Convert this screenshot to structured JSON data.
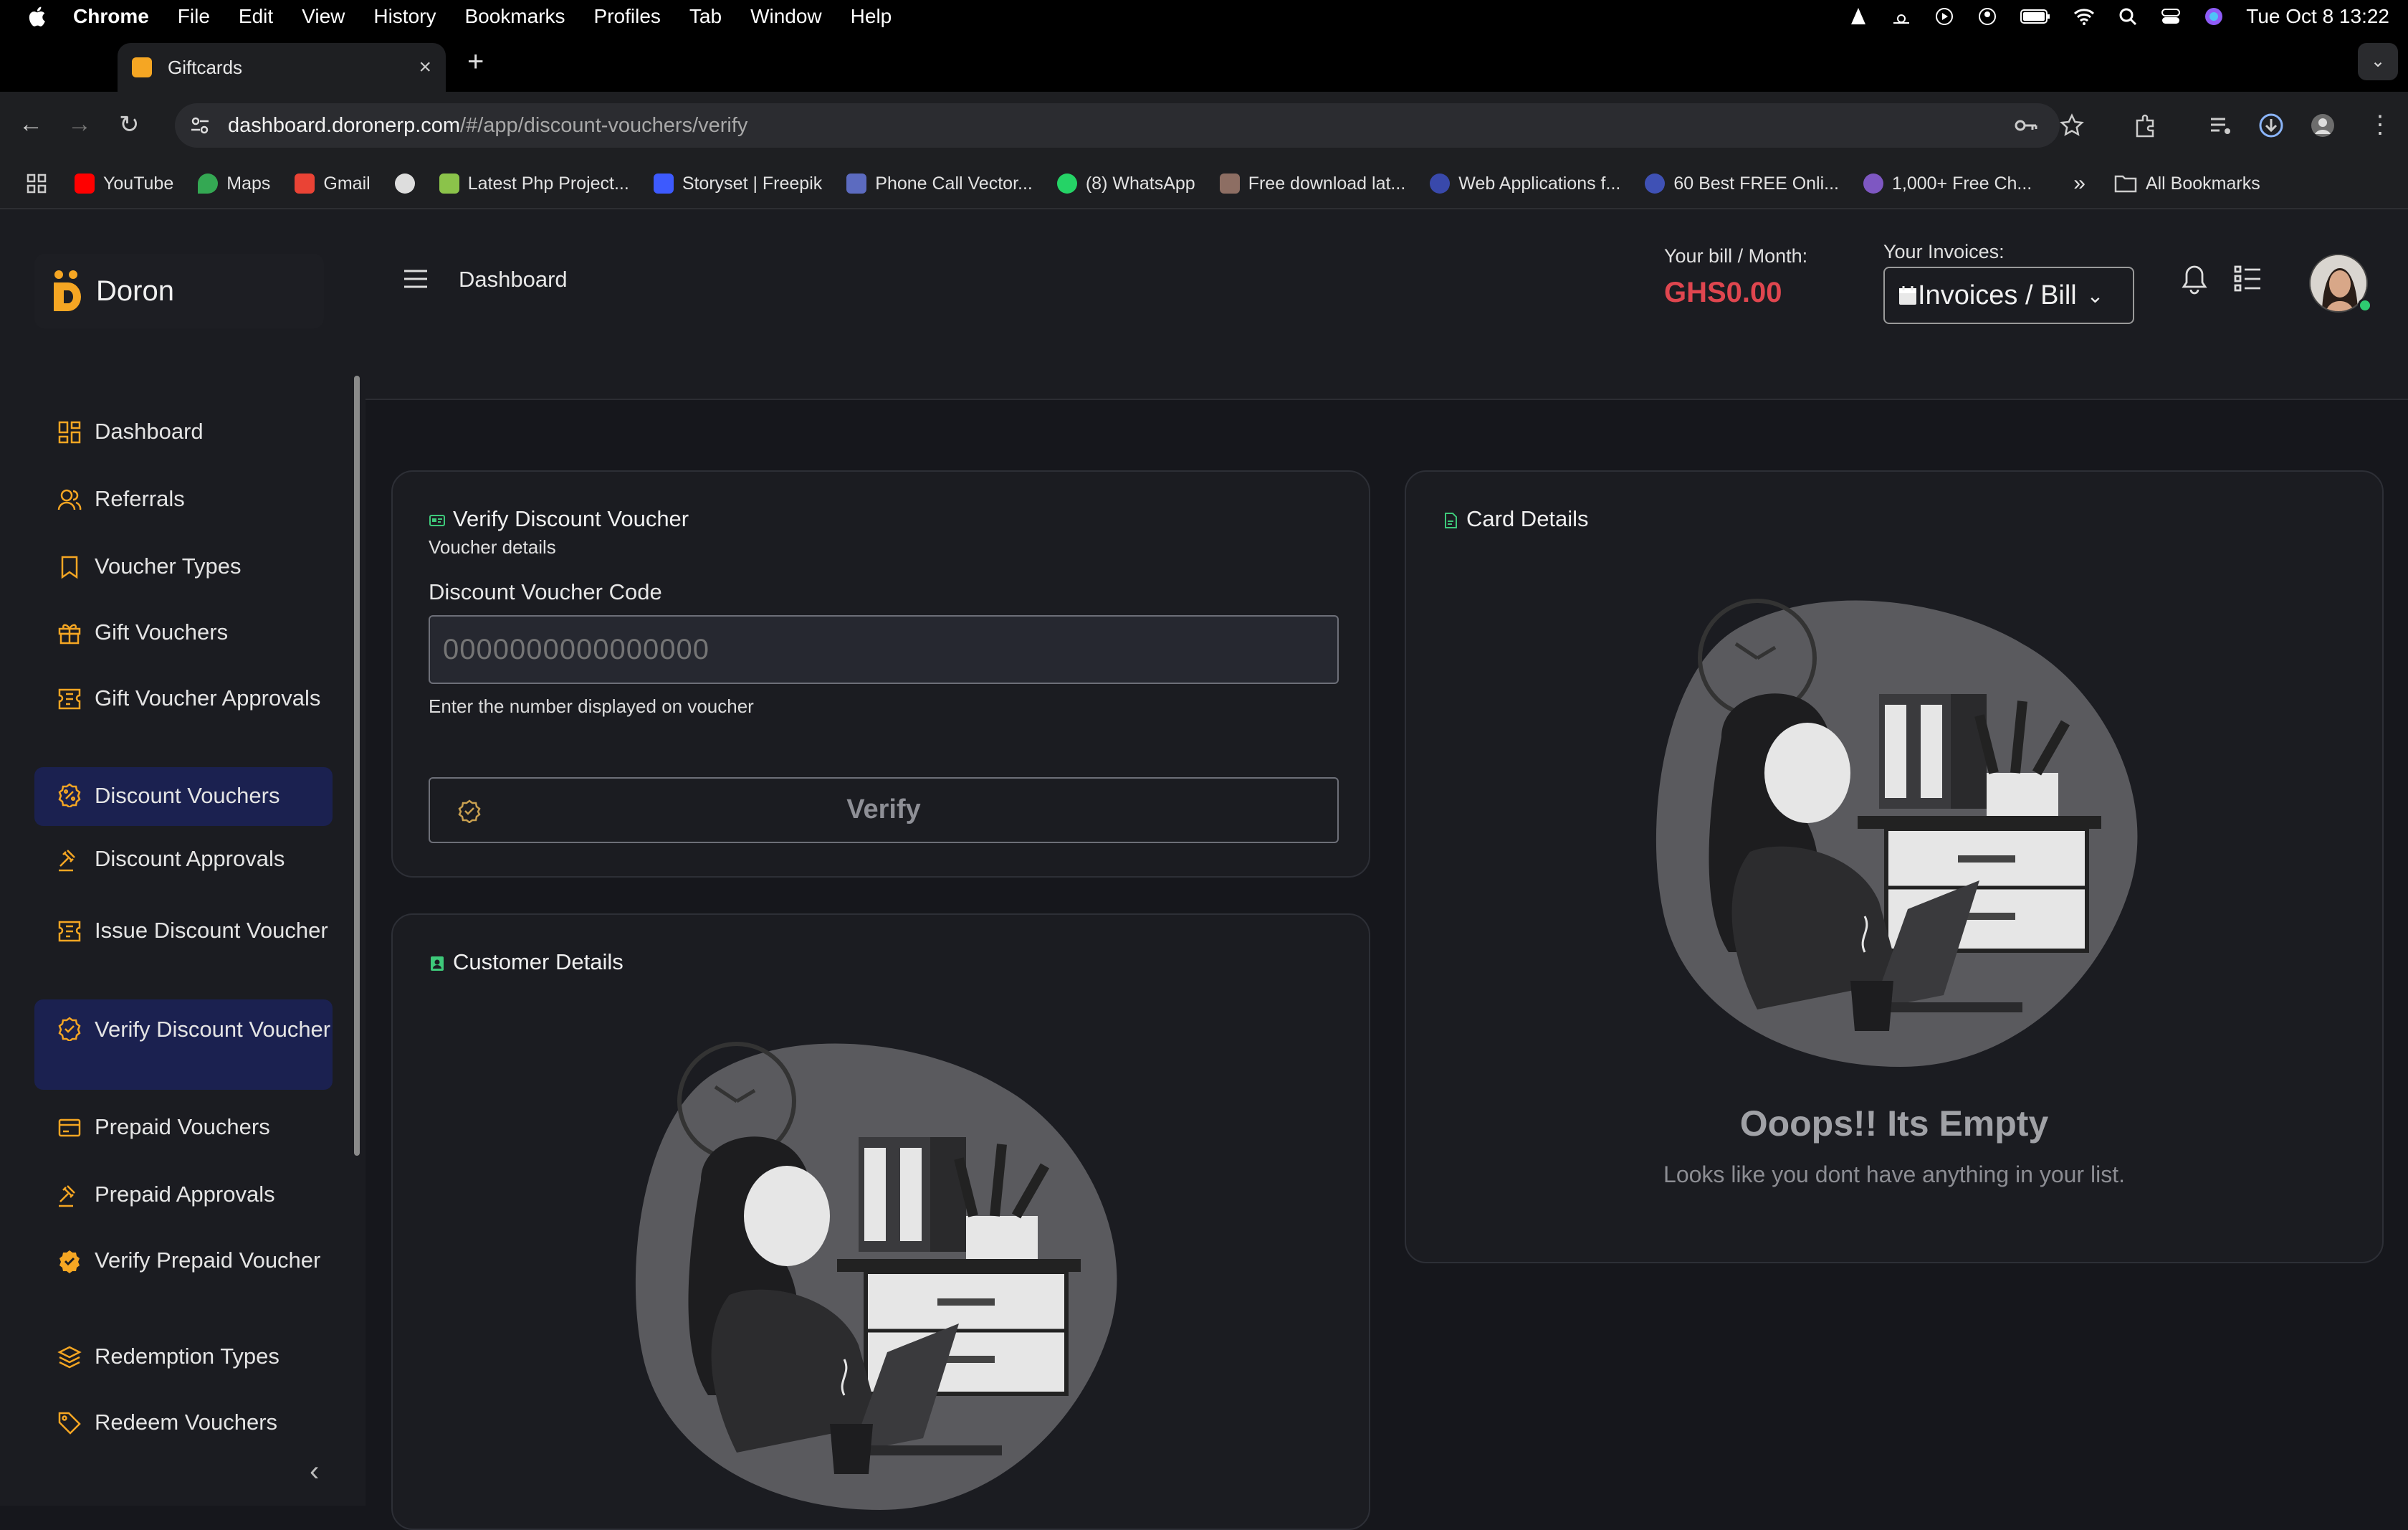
{
  "system_menubar": {
    "app_name": "Chrome",
    "menus": [
      "File",
      "Edit",
      "View",
      "History",
      "Bookmarks",
      "Profiles",
      "Tab",
      "Window",
      "Help"
    ],
    "datetime": "Tue Oct 8  13:22"
  },
  "browser": {
    "tab_title": "Giftcards",
    "url_host": "dashboard.doronerp.com",
    "url_path": "/#/app/discount-vouchers/verify",
    "bookmarks": [
      {
        "label": "YouTube",
        "color": "#ff0000"
      },
      {
        "label": "Maps",
        "color": "#34a853"
      },
      {
        "label": "Gmail",
        "color": "#ea4335"
      },
      {
        "label": "",
        "color": "#cccccc"
      },
      {
        "label": "Latest Php Project...",
        "color": "#8bc34a"
      },
      {
        "label": "Storyset | Freepik",
        "color": "#3d5afe"
      },
      {
        "label": "Phone Call Vector...",
        "color": "#5c6bc0"
      },
      {
        "label": "(8) WhatsApp",
        "color": "#25d366"
      },
      {
        "label": "Free download lat...",
        "color": "#8d6e63"
      },
      {
        "label": "Web Applications f...",
        "color": "#3949ab"
      },
      {
        "label": "60 Best FREE Onli...",
        "color": "#3f51b5"
      },
      {
        "label": "1,000+ Free Ch...",
        "color": "#7e57c2"
      }
    ],
    "all_bookmarks_label": "All Bookmarks"
  },
  "brand": {
    "name": "Doron",
    "color": "#f5a623"
  },
  "sidebar": {
    "items": [
      {
        "label": "Dashboard",
        "icon": "dashboard-icon"
      },
      {
        "label": "Referrals",
        "icon": "users-icon"
      },
      {
        "label": "Voucher Types",
        "icon": "bookmark-icon"
      },
      {
        "label": "Gift Vouchers",
        "icon": "gift-icon"
      },
      {
        "label": "Gift Voucher Approvals",
        "icon": "ticket-icon"
      },
      {
        "label": "Discount Vouchers",
        "icon": "discount-icon"
      },
      {
        "label": "Discount Approvals",
        "icon": "gavel-icon"
      },
      {
        "label": "Issue Discount Voucher",
        "icon": "ticket-icon"
      },
      {
        "label": "Verify Discount Voucher",
        "icon": "verify-icon"
      },
      {
        "label": "Prepaid Vouchers",
        "icon": "card-icon"
      },
      {
        "label": "Prepaid Approvals",
        "icon": "gavel-icon"
      },
      {
        "label": "Verify Prepaid Voucher",
        "icon": "verified-badge-icon"
      },
      {
        "label": "Redemption Types",
        "icon": "layers-icon"
      },
      {
        "label": "Redeem Vouchers",
        "icon": "tag-icon"
      }
    ],
    "accent_color": "#f5a623"
  },
  "topbar": {
    "breadcrumb": "Dashboard",
    "bill_label": "Your bill / Month:",
    "bill_value": "GHS0.00",
    "invoices_label": "Your Invoices:",
    "invoices_select": "Invoices / Bill"
  },
  "verify_card": {
    "title": "Verify Discount Voucher",
    "subtitle": "Voucher details",
    "field_label": "Discount Voucher Code",
    "placeholder": "0000000000000000",
    "help": "Enter the number displayed on voucher",
    "button": "Verify"
  },
  "customer_card": {
    "title": "Customer Details"
  },
  "card_details": {
    "title": "Card Details",
    "empty_title": "Ooops!! Its Empty",
    "empty_text": "Looks like you dont have anything in your list."
  }
}
